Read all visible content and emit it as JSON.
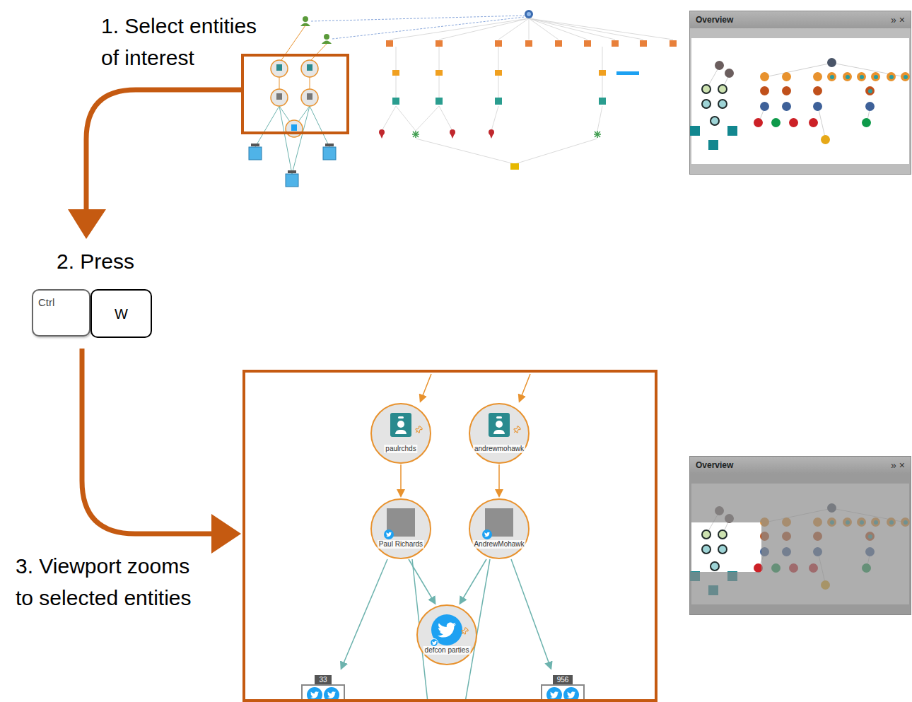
{
  "step1": {
    "lines": [
      "1. Select entities",
      "of interest"
    ]
  },
  "step2": {
    "label": "2. Press",
    "keys": [
      {
        "label": "Ctrl",
        "kind": "modifier"
      },
      {
        "label": "W",
        "kind": "letter"
      }
    ]
  },
  "step3": {
    "lines": [
      "3. Viewport zooms",
      "to selected entities"
    ]
  },
  "overview_panels": [
    {
      "title": "Overview",
      "controls": [
        "»",
        "×"
      ],
      "viewport_shown": false
    },
    {
      "title": "Overview",
      "controls": [
        "»",
        "×"
      ],
      "viewport_shown": true
    }
  ],
  "overview_nodes": [
    {
      "kind": "circle",
      "color": "#6b5e5e"
    },
    {
      "kind": "circle",
      "color": "#6b5e5e"
    },
    {
      "kind": "circle",
      "color": "#4a5568"
    },
    {
      "kind": "circle",
      "color": "#e8922e"
    },
    {
      "kind": "circle",
      "color": "#e8922e"
    },
    {
      "kind": "circle",
      "color": "#e8922e"
    },
    {
      "kind": "ring",
      "color": "#e8922e"
    },
    {
      "kind": "ring",
      "color": "#e8922e"
    },
    {
      "kind": "ring",
      "color": "#e8922e"
    },
    {
      "kind": "ring",
      "color": "#e8922e"
    },
    {
      "kind": "ring",
      "color": "#e8922e"
    },
    {
      "kind": "ring",
      "color": "#e8922e"
    },
    {
      "kind": "circle",
      "color": "#c0501b"
    },
    {
      "kind": "circle",
      "color": "#c0501b"
    },
    {
      "kind": "circle",
      "color": "#c0501b"
    },
    {
      "kind": "ring",
      "color": "#c0501b"
    },
    {
      "kind": "circle",
      "color": "#3e6199"
    },
    {
      "kind": "circle",
      "color": "#3e6199"
    },
    {
      "kind": "circle",
      "color": "#3e6199"
    },
    {
      "kind": "circle",
      "color": "#3e6199"
    },
    {
      "kind": "outlined",
      "color": "#cde2b0"
    },
    {
      "kind": "outlined",
      "color": "#cde2b0"
    },
    {
      "kind": "outlined",
      "color": "#9ed4d6"
    },
    {
      "kind": "outlined",
      "color": "#9ed4d6"
    },
    {
      "kind": "outlined",
      "color": "#9ed4d6"
    },
    {
      "kind": "circle",
      "color": "#cc2127"
    },
    {
      "kind": "circle",
      "color": "#0e9a4a"
    },
    {
      "kind": "circle",
      "color": "#cc2127"
    },
    {
      "kind": "circle",
      "color": "#cc2127"
    },
    {
      "kind": "circle",
      "color": "#0e9a4a"
    },
    {
      "kind": "circle",
      "color": "#e6a817"
    },
    {
      "kind": "square",
      "color": "#12878f"
    },
    {
      "kind": "square",
      "color": "#12878f"
    },
    {
      "kind": "square",
      "color": "#12878f"
    }
  ],
  "zoomed_view": {
    "nodes": [
      {
        "label": "paulrchds",
        "kind": "account",
        "pinned": true
      },
      {
        "label": "andrewmohawk",
        "kind": "account",
        "pinned": true
      },
      {
        "label": "Paul Richards",
        "kind": "photo",
        "pinned": false
      },
      {
        "label": "AndrewMohawk",
        "kind": "photo",
        "pinned": false
      },
      {
        "label": "defcon parties",
        "kind": "twitter",
        "pinned": true
      }
    ],
    "badges": [
      {
        "count": "33"
      },
      {
        "count": "956"
      }
    ]
  }
}
